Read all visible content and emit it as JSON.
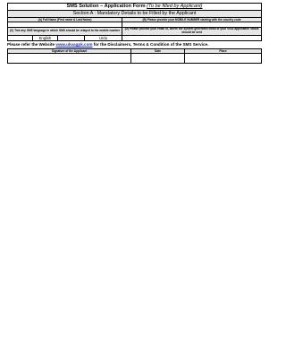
{
  "form": {
    "title_main": "SMS Solution – Application  Form ",
    "title_note": "(To be filled by Applicant)",
    "section_a": "Section A : Mandatory Details to be Filled by the Applicant",
    "field_a_label": "(A) Full Name (First name & Last Name)",
    "field_b_label": "(B) Please provide your MOBILE NUMBER starting with the country code",
    "field_c_label": "(C) Tick any ONE language in which SMS should be relayed to the mobile number",
    "field_d_label": "(D) Please provide your email id, where the system generated email of your VISA application status should be sent",
    "language_options": [
      "English",
      "Urdu"
    ],
    "website_prefix": "Please refer the Website ",
    "website_link": "www.ukvagpk.com",
    "website_suffix": " for the Disclaimers, Terms & Condition of the SMS Service.",
    "signature_label": "Signature of the Applicant",
    "date_label": "Date",
    "place_label": "Place"
  },
  "colors": {
    "header_fill": "#e6e6e6",
    "link": "#1f2fd6",
    "border": "#000000"
  }
}
